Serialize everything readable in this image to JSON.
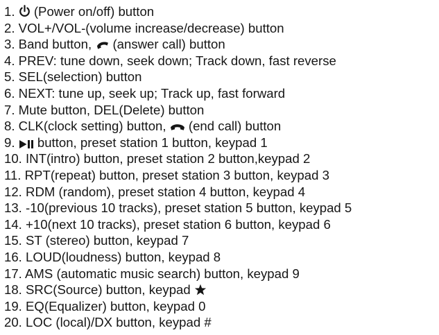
{
  "icons": {
    "power": "power-icon",
    "answer_call": "phone-answer-icon",
    "end_call": "phone-hangup-icon",
    "play_pause": "play-pause-icon",
    "star": "star-icon"
  },
  "items": [
    {
      "pre": "1. ",
      "icon": "power",
      "post": " (Power on/off) button"
    },
    {
      "pre": "2. VOL+/VOL-(volume increase/decrease) button"
    },
    {
      "pre": "3. Band button, ",
      "icon": "answer_call",
      "post": " (answer call) button"
    },
    {
      "pre": "4. PREV: tune down, seek down; Track down, fast reverse"
    },
    {
      "pre": "5. SEL(selection) button"
    },
    {
      "pre": "6. NEXT: tune up, seek up; Track up, fast forward"
    },
    {
      "pre": "7. Mute button, DEL(Delete) button"
    },
    {
      "pre": "8. CLK(clock setting) button, ",
      "icon": "end_call",
      "post": " (end call) button"
    },
    {
      "pre": "9. ",
      "icon": "play_pause",
      "post": " button, preset station 1 button, keypad 1"
    },
    {
      "pre": "10. INT(intro) button, preset station 2 button,keypad 2"
    },
    {
      "pre": "11. RPT(repeat) button, preset station 3 button, keypad 3"
    },
    {
      "pre": "12. RDM (random), preset station 4 button, keypad 4"
    },
    {
      "pre": "13. -10(previous 10 tracks), preset station 5 button, keypad 5"
    },
    {
      "pre": "14. +10(next 10 tracks), preset station 6 button, keypad 6"
    },
    {
      "pre": "15. ST (stereo) button, keypad 7"
    },
    {
      "pre": "16. LOUD(loudness) button, keypad 8"
    },
    {
      "pre": "17. AMS (automatic music search) button, keypad 9"
    },
    {
      "pre": "18. SRC(Source) button, keypad ",
      "icon": "star",
      "post": ""
    },
    {
      "pre": "19. EQ(Equalizer) button, keypad 0"
    },
    {
      "pre": "20. LOC (local)/DX button, keypad #"
    }
  ]
}
